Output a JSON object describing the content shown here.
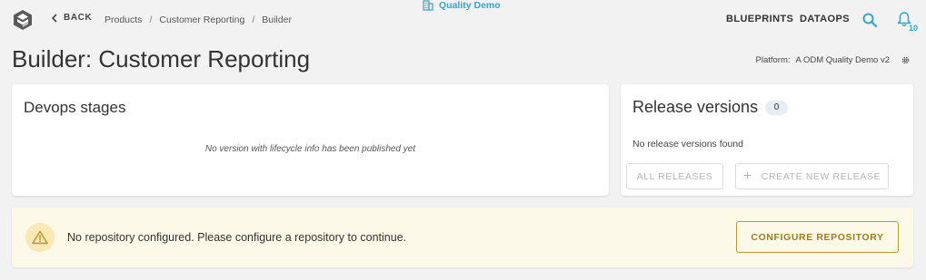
{
  "header": {
    "back_label": "BACK",
    "breadcrumb": [
      "Products",
      "Customer Reporting",
      "Builder"
    ],
    "tenant_name": "Quality Demo",
    "nav": {
      "blueprints": "BLUEPRINTS",
      "dataops": "DATAOPS"
    },
    "notification_count": "10",
    "accent_color": "#39a3c9"
  },
  "page": {
    "title": "Builder: Customer Reporting",
    "platform_label": "Platform:",
    "platform_value": "A ODM Quality Demo v2"
  },
  "devops": {
    "title": "Devops stages",
    "empty_message": "No version with lifecycle info has been published yet"
  },
  "releases": {
    "title": "Release versions",
    "count": "0",
    "empty_message": "No release versions found",
    "all_releases_label": "ALL RELEASES",
    "create_release_label": "CREATE NEW RELEASE"
  },
  "warning": {
    "message": "No repository configured. Please configure a repository to continue.",
    "action_label": "CONFIGURE REPOSITORY",
    "icon": "warning-triangle-icon",
    "color": "#b89a35"
  }
}
